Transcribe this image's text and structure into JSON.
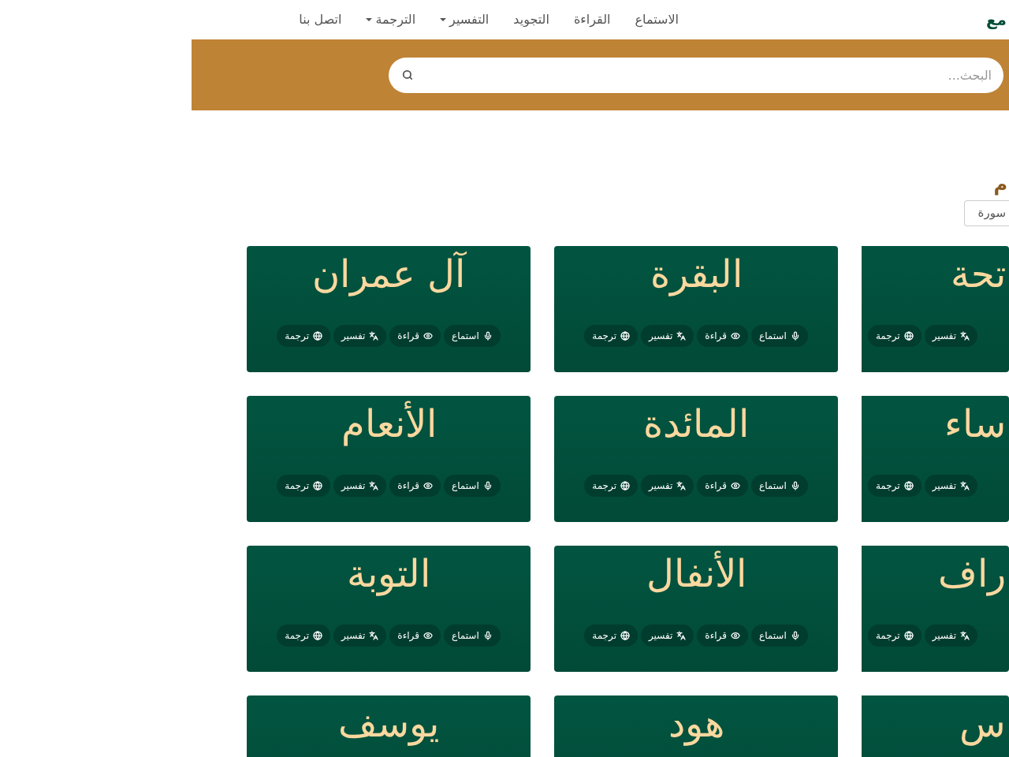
{
  "navbar": {
    "logo": "مع",
    "links": [
      {
        "label": "الاستماع",
        "dropdown": false
      },
      {
        "label": "القراءة",
        "dropdown": false
      },
      {
        "label": "التجويد",
        "dropdown": false
      },
      {
        "label": "التفسير",
        "dropdown": true
      },
      {
        "label": "الترجمة",
        "dropdown": true
      },
      {
        "label": "اتصل بنا",
        "dropdown": false
      }
    ]
  },
  "search": {
    "placeholder": "البحث..."
  },
  "heading": "م",
  "sort_select": {
    "value": "سورة"
  },
  "cards": [
    {
      "title": "تحة",
      "actions": [
        {
          "kind": "tafsir",
          "label": "تفسير"
        },
        {
          "kind": "translation",
          "label": "ترجمة"
        }
      ]
    },
    {
      "title": "البقرة",
      "actions": [
        {
          "kind": "listen",
          "label": "استماع"
        },
        {
          "kind": "read",
          "label": "قراءة"
        },
        {
          "kind": "tafsir",
          "label": "تفسير"
        },
        {
          "kind": "translation",
          "label": "ترجمة"
        }
      ]
    },
    {
      "title": "آل عمران",
      "actions": [
        {
          "kind": "listen",
          "label": "استماع"
        },
        {
          "kind": "read",
          "label": "قراءة"
        },
        {
          "kind": "tafsir",
          "label": "تفسير"
        },
        {
          "kind": "translation",
          "label": "ترجمة"
        }
      ]
    },
    {
      "title": "ساء",
      "actions": [
        {
          "kind": "tafsir",
          "label": "تفسير"
        },
        {
          "kind": "translation",
          "label": "ترجمة"
        }
      ]
    },
    {
      "title": "المائدة",
      "actions": [
        {
          "kind": "listen",
          "label": "استماع"
        },
        {
          "kind": "read",
          "label": "قراءة"
        },
        {
          "kind": "tafsir",
          "label": "تفسير"
        },
        {
          "kind": "translation",
          "label": "ترجمة"
        }
      ]
    },
    {
      "title": "الأنعام",
      "actions": [
        {
          "kind": "listen",
          "label": "استماع"
        },
        {
          "kind": "read",
          "label": "قراءة"
        },
        {
          "kind": "tafsir",
          "label": "تفسير"
        },
        {
          "kind": "translation",
          "label": "ترجمة"
        }
      ]
    },
    {
      "title": "راف",
      "actions": [
        {
          "kind": "tafsir",
          "label": "تفسير"
        },
        {
          "kind": "translation",
          "label": "ترجمة"
        }
      ]
    },
    {
      "title": "الأنفال",
      "actions": [
        {
          "kind": "listen",
          "label": "استماع"
        },
        {
          "kind": "read",
          "label": "قراءة"
        },
        {
          "kind": "tafsir",
          "label": "تفسير"
        },
        {
          "kind": "translation",
          "label": "ترجمة"
        }
      ]
    },
    {
      "title": "التوبة",
      "actions": [
        {
          "kind": "listen",
          "label": "استماع"
        },
        {
          "kind": "read",
          "label": "قراءة"
        },
        {
          "kind": "tafsir",
          "label": "تفسير"
        },
        {
          "kind": "translation",
          "label": "ترجمة"
        }
      ]
    },
    {
      "title": "س"
    },
    {
      "title": "هود"
    },
    {
      "title": "يوسف"
    }
  ]
}
